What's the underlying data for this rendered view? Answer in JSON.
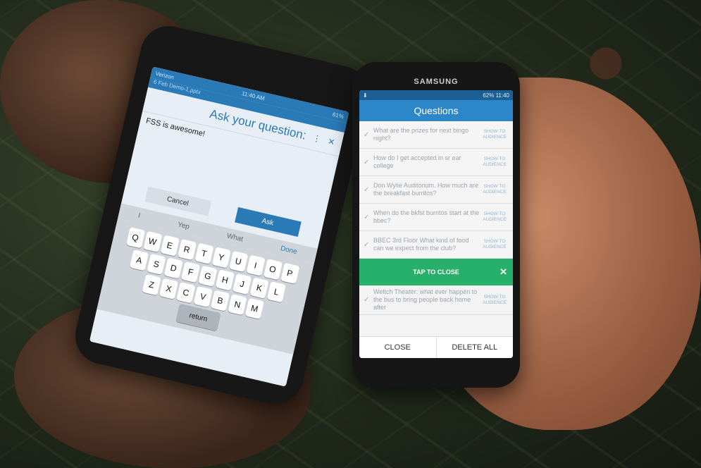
{
  "iphone": {
    "status_left": "Verizon",
    "status_time": "11:40 AM",
    "status_right": "61%",
    "file_name": "6 Feb Demo-1.pptx",
    "title": "Ask your question:",
    "input_value": "FSS is awesome!",
    "cancel_label": "Cancel",
    "ask_label": "Ask",
    "done_label": "Done",
    "suggestions": [
      "I",
      "Yep",
      "What"
    ],
    "kb_row1": [
      "Q",
      "W",
      "E",
      "R",
      "T",
      "Y",
      "U",
      "I",
      "O",
      "P"
    ],
    "kb_row2": [
      "A",
      "S",
      "D",
      "F",
      "G",
      "H",
      "J",
      "K",
      "L"
    ],
    "kb_row3": [
      "Z",
      "X",
      "C",
      "V",
      "B",
      "N",
      "M"
    ],
    "return_label": "return"
  },
  "samsung": {
    "brand": "SAMSUNG",
    "status_right": "62% 11:40",
    "title": "Questions",
    "show_label": "SHOW TO AUDIENCE",
    "questions": [
      {
        "text": "What are the prizes for next bingo night?"
      },
      {
        "text": "How do I get accepted in sr ear college"
      },
      {
        "text": "Don Wylie Auditorium. How much are the breakfast burritos?"
      },
      {
        "text": "When do the bkfst burritos start at the bbec?"
      },
      {
        "text": "BBEC 3rd Floor What kind of food can we expect from the club?"
      }
    ],
    "toast_label": "TAP TO CLOSE",
    "after_toast": {
      "text": "Weltch Theater: what ever happen to the bus to bring people back home after"
    },
    "close_label": "CLOSE",
    "delete_label": "DELETE ALL"
  }
}
